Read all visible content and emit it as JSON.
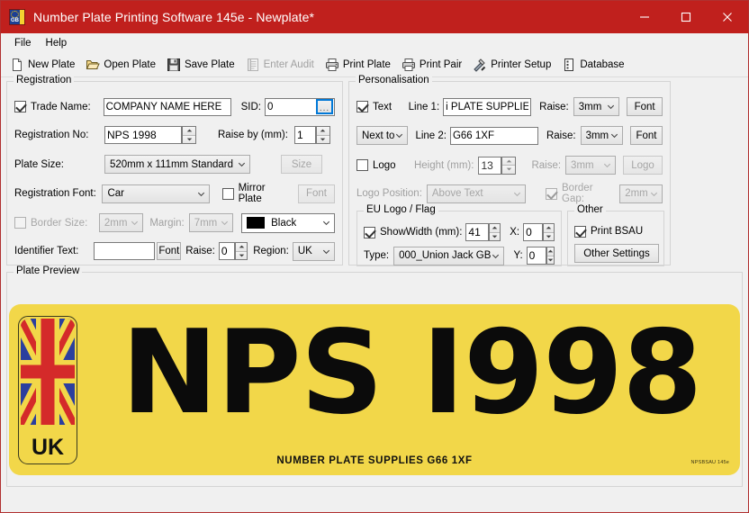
{
  "window": {
    "title": "Number Plate Printing Software 145e - Newplate*",
    "app_icon": "gb-euro-badge-icon",
    "minimize_label": "–",
    "maximize_label": "□",
    "close_label": "✕",
    "titlebar_color": "#c0201d"
  },
  "menubar": {
    "items": [
      {
        "label": "File"
      },
      {
        "label": "Help"
      }
    ]
  },
  "toolbar": {
    "items": [
      {
        "label": "New Plate",
        "icon": "new-document-icon",
        "disabled": false
      },
      {
        "label": "Open Plate",
        "icon": "open-folder-icon",
        "disabled": false
      },
      {
        "label": "Save Plate",
        "icon": "floppy-disk-icon",
        "disabled": false
      },
      {
        "label": "Enter Audit",
        "icon": "audit-list-icon",
        "disabled": true
      },
      {
        "label": "Print Plate",
        "icon": "printer-icon",
        "disabled": false
      },
      {
        "label": "Print Pair",
        "icon": "printer-icon",
        "disabled": false
      },
      {
        "label": "Printer Setup",
        "icon": "hammer-wrench-icon",
        "disabled": false
      },
      {
        "label": "Database",
        "icon": "database-icon",
        "disabled": false
      }
    ]
  },
  "registration": {
    "title": "Registration",
    "trade_name": {
      "label": "Trade Name:",
      "checked": true,
      "value": "COMPANY NAME HERE"
    },
    "sid": {
      "label": "SID:",
      "value": "0",
      "browse_label": "..."
    },
    "registration_no": {
      "label": "Registration No:",
      "value": "NPS 1998"
    },
    "raise_by": {
      "label": "Raise by (mm):",
      "value": "1"
    },
    "plate_size": {
      "label": "Plate Size:",
      "value": "520mm x 111mm Standard"
    },
    "size_button": {
      "label": "Size",
      "disabled": true
    },
    "registration_font": {
      "label": "Registration Font:",
      "value": "Car"
    },
    "mirror_plate": {
      "label": "Mirror Plate",
      "checked": false
    },
    "mirror_font_button": {
      "label": "Font",
      "disabled": true
    },
    "border_size": {
      "label": "Border Size:",
      "checked": false,
      "value": "2mm"
    },
    "margin": {
      "label": "Margin:",
      "value": "7mm"
    },
    "colour": {
      "value": "Black",
      "swatch": "#000000"
    },
    "identifier_text": {
      "label": "Identifier Text:",
      "value": ""
    },
    "identifier_font_button": {
      "label": "Font"
    },
    "identifier_raise": {
      "label": "Raise:",
      "value": "0"
    },
    "region": {
      "label": "Region:",
      "value": "UK"
    }
  },
  "personalisation": {
    "title": "Personalisation",
    "text_checkbox": {
      "label": "Text",
      "checked": true
    },
    "line1": {
      "label": "Line 1:",
      "value": "i PLATE SUPPLIES",
      "raise_label": "Raise:",
      "raise_value": "3mm",
      "font_button": "Font"
    },
    "position": {
      "value": "Next to"
    },
    "line2": {
      "label": "Line 2:",
      "value": "G66 1XF",
      "raise_label": "Raise:",
      "raise_value": "3mm",
      "font_button": "Font"
    },
    "logo_checkbox": {
      "label": "Logo",
      "checked": false
    },
    "logo_height": {
      "label": "Height (mm):",
      "value": "13"
    },
    "logo_raise": {
      "label": "Raise:",
      "value": "3mm"
    },
    "logo_button": {
      "label": "Logo"
    },
    "logo_position": {
      "label": "Logo Position:",
      "value": "Above Text"
    },
    "border_gap": {
      "label": "Border Gap:",
      "checked": true,
      "value": "2mm"
    },
    "eu_logo": {
      "title": "EU Logo / Flag",
      "show": {
        "label": "Show",
        "checked": true
      },
      "width": {
        "label": "Width (mm):",
        "value": "41"
      },
      "x": {
        "label": "X:",
        "value": "0"
      },
      "y": {
        "label": "Y:",
        "value": "0"
      },
      "type": {
        "label": "Type:",
        "value": "000_Union Jack GB"
      }
    },
    "other": {
      "title": "Other",
      "print_bsau": {
        "label": "Print BSAU",
        "checked": true
      },
      "other_settings_button": {
        "label": "Other Settings"
      }
    }
  },
  "preview": {
    "title": "Plate Preview",
    "plate_background": "#f2d749",
    "plate_text_color": "#0b0b0b",
    "registration": "NPS I998",
    "sub_line": "NUMBER PLATE SUPPLIES   G66 1XF",
    "bsau_mark": "NPSBSAU 145e",
    "flag": {
      "country_label": "UK",
      "type": "union-jack-gb"
    }
  }
}
